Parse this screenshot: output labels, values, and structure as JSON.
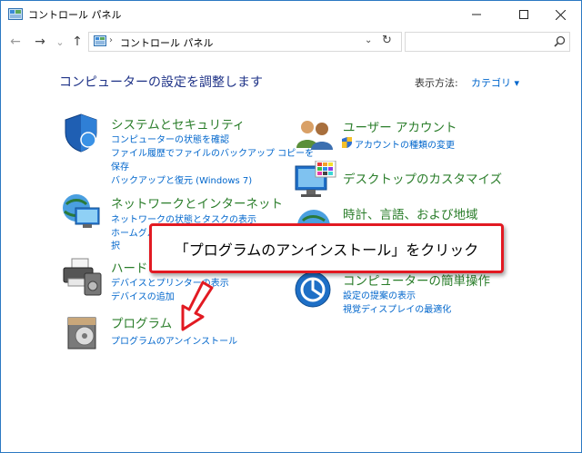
{
  "window": {
    "title": "コントロール パネル",
    "controls": {
      "minimize": "—",
      "maximize": "☐",
      "close": "✕"
    }
  },
  "nav": {
    "back": "←",
    "forward": "→",
    "recent": "⌄",
    "up": "↑",
    "address_separator": "›",
    "address": "コントロール パネル",
    "address_dropdown": "⌄",
    "refresh": "↻",
    "search_placeholder": ""
  },
  "main": {
    "heading": "コンピューターの設定を調整します",
    "view_by_label": "表示方法:",
    "view_by_value": "カテゴリ ▾"
  },
  "categories": [
    {
      "title": "システムとセキュリティ",
      "icon": "shield-icon",
      "links": [
        "コンピューターの状態を確認",
        "ファイル履歴でファイルのバックアップ コピーを",
        "保存",
        "バックアップと復元 (Windows 7)"
      ]
    },
    {
      "title": "ネットワークとインターネット",
      "icon": "network-icon",
      "links": [
        "ネットワークの状態とタスクの表示",
        "ホームグル",
        "択"
      ]
    },
    {
      "title": "ハードウ",
      "icon": "printer-icon",
      "links": [
        "デバイスとプリンターの表示",
        "デバイスの追加"
      ]
    },
    {
      "title": "プログラム",
      "icon": "programs-icon",
      "links": [
        "プログラムのアンインストール"
      ]
    },
    {
      "title": "ユーザー アカウント",
      "icon": "users-icon",
      "links": [
        "アカウントの種類の変更"
      ]
    },
    {
      "title": "デスクトップのカスタマイズ",
      "icon": "desktop-icon",
      "links": []
    },
    {
      "title": "時計、言語、および地域",
      "icon": "globe-icon",
      "links": []
    },
    {
      "title": "コンピューターの簡単操作",
      "icon": "accessibility-icon",
      "links": [
        "設定の提案の表示",
        "視覚ディスプレイの最適化"
      ]
    }
  ],
  "callout": {
    "text": "「プログラムのアンインストール」をクリック"
  },
  "colors": {
    "accent": "#0066cc",
    "category_title": "#2a7d2a",
    "heading": "#1e3287",
    "callout_border": "#e21a22"
  }
}
